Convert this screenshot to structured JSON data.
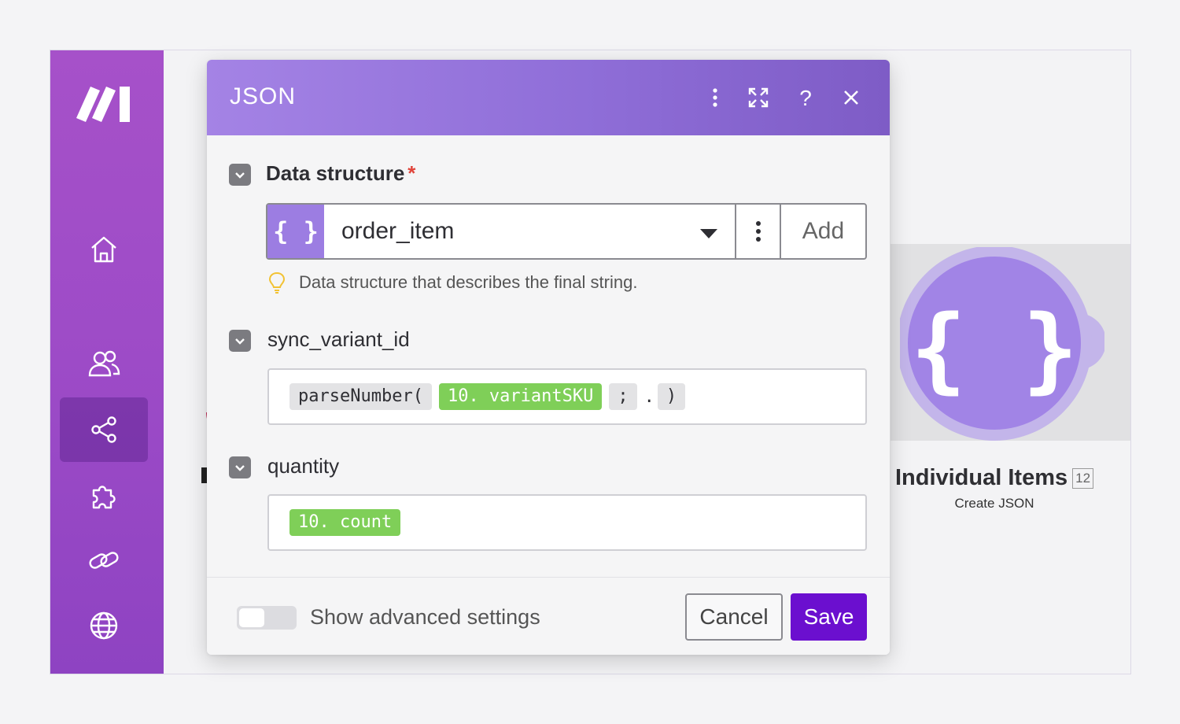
{
  "dialog": {
    "title": "JSON",
    "header_icons": [
      "more-vertical-icon",
      "expand-icon",
      "help-icon",
      "close-icon"
    ],
    "data_structure": {
      "label": "Data structure",
      "required_mark": "*",
      "icon_text": "{ }",
      "selected_value": "order_item",
      "add_label": "Add",
      "hint": "Data structure that describes the final string."
    },
    "fields": [
      {
        "label": "sync_variant_id",
        "tokens": [
          {
            "text": "parseNumber(",
            "style": "gray"
          },
          {
            "text": "10. variantSKU",
            "style": "green"
          },
          {
            "text": ";",
            "style": "gray"
          },
          {
            "text": ".",
            "style": "plain"
          },
          {
            "text": ")",
            "style": "gray"
          }
        ]
      },
      {
        "label": "quantity",
        "tokens": [
          {
            "text": "10. count",
            "style": "green"
          }
        ]
      }
    ],
    "footer": {
      "toggle_label": "Show advanced settings",
      "toggle_on": false,
      "cancel_label": "Cancel",
      "save_label": "Save"
    }
  },
  "canvas": {
    "node_title": "Individual Items",
    "node_badge": "12",
    "node_subtitle": "Create JSON",
    "node_icon_text": "{ }"
  },
  "sidebar": {
    "items": [
      "home-icon",
      "users-icon",
      "share-icon",
      "puzzle-icon",
      "link-icon",
      "globe-icon"
    ],
    "active_index": 2
  },
  "colors": {
    "sidebar": "#a651c9",
    "header": "#8f6ed8",
    "save_button": "#6b0fcf",
    "token_green": "#7fcf58",
    "node_purple": "#a184e6"
  }
}
